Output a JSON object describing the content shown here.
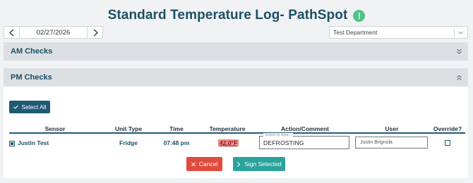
{
  "header": {
    "title": "Standard Temperature Log- PathSpot",
    "info_glyph": "!"
  },
  "date_nav": {
    "date": "02/27/2026",
    "prev_icon": "chevron-left-icon",
    "next_icon": "chevron-right-icon"
  },
  "department_select": {
    "selected": "Test Department"
  },
  "am_section": {
    "title": "AM Checks",
    "toggle_icon": "chevron-double-down-icon"
  },
  "pm_section": {
    "title": "PM Checks",
    "toggle_icon": "chevron-double-up-icon",
    "select_all_label": "Select All",
    "columns": [
      "Sensor",
      "Unit Type",
      "Time",
      "Temperature",
      "Action/Comment",
      "User",
      "Override?"
    ],
    "rows": [
      {
        "selected": true,
        "sensor": "Justin Test",
        "unit_type": "Fridge",
        "time": "07:48 pm",
        "temperature": "42.0°F",
        "action_placeholder": "Select or type...",
        "action_value": "DEFROSTING",
        "user": "Justin Brignola",
        "override": false
      }
    ],
    "cancel_label": "Cancel",
    "sign_label": "Sign Selected"
  },
  "colors": {
    "title": "#1b4f66",
    "accent": "#1f5a75",
    "danger": "#e14b3d",
    "success": "#2aa39b",
    "info_badge": "#4cc585",
    "temp_alert_bg": "#f08c8c"
  }
}
